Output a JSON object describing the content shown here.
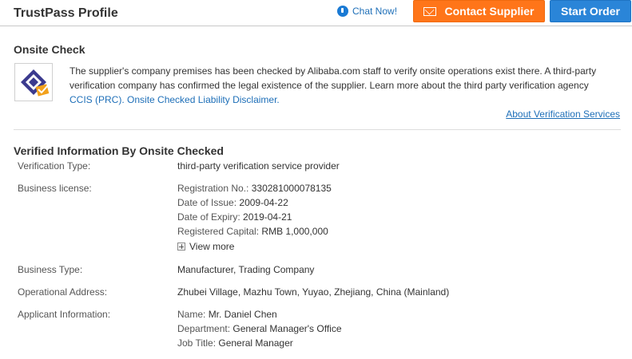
{
  "header": {
    "title": "TrustPass Profile",
    "chat_label": "Chat Now!",
    "contact_label": "Contact Supplier",
    "order_label": "Start Order"
  },
  "onsite": {
    "title": "Onsite Check",
    "description": "The supplier's company premises has been checked by Alibaba.com staff to verify onsite operations exist there. A third-party verification company has confirmed the legal existence of the supplier. Learn more about the third party verification agency",
    "ccis_link": "CCIS (PRC).",
    "disclaimer_link": "Onsite Checked Liability Disclaimer.",
    "about_link": "About Verification Services"
  },
  "verified": {
    "title": "Verified Information By Onsite Checked",
    "verification_type": {
      "label": "Verification Type:",
      "value": "third-party verification service provider"
    },
    "business_license": {
      "label": "Business license:",
      "registration_no": {
        "k": "Registration No.:",
        "v": "330281000078135"
      },
      "date_of_issue": {
        "k": "Date of Issue:",
        "v": "2009-04-22"
      },
      "date_of_expiry": {
        "k": "Date of Expiry:",
        "v": "2019-04-21"
      },
      "registered_capital": {
        "k": "Registered Capital:",
        "v": "RMB 1,000,000"
      },
      "view_more": "View more"
    },
    "business_type": {
      "label": "Business Type:",
      "value": "Manufacturer, Trading Company"
    },
    "operational_address": {
      "label": "Operational Address:",
      "value": "Zhubei Village, Mazhu Town, Yuyao, Zhejiang, China (Mainland)"
    },
    "applicant": {
      "label": "Applicant Information:",
      "name": {
        "k": "Name:",
        "v": "Mr. Daniel Chen"
      },
      "department": {
        "k": "Department:",
        "v": "General Manager's Office"
      },
      "job_title": {
        "k": "Job Title:",
        "v": "General Manager"
      }
    }
  },
  "colors": {
    "accent_orange": "#ff7519",
    "accent_blue": "#2a85d8",
    "link_blue": "#1e6fb8"
  },
  "icons": [
    "chat-icon",
    "mail-icon",
    "onsite-check-icon",
    "plus-icon"
  ]
}
